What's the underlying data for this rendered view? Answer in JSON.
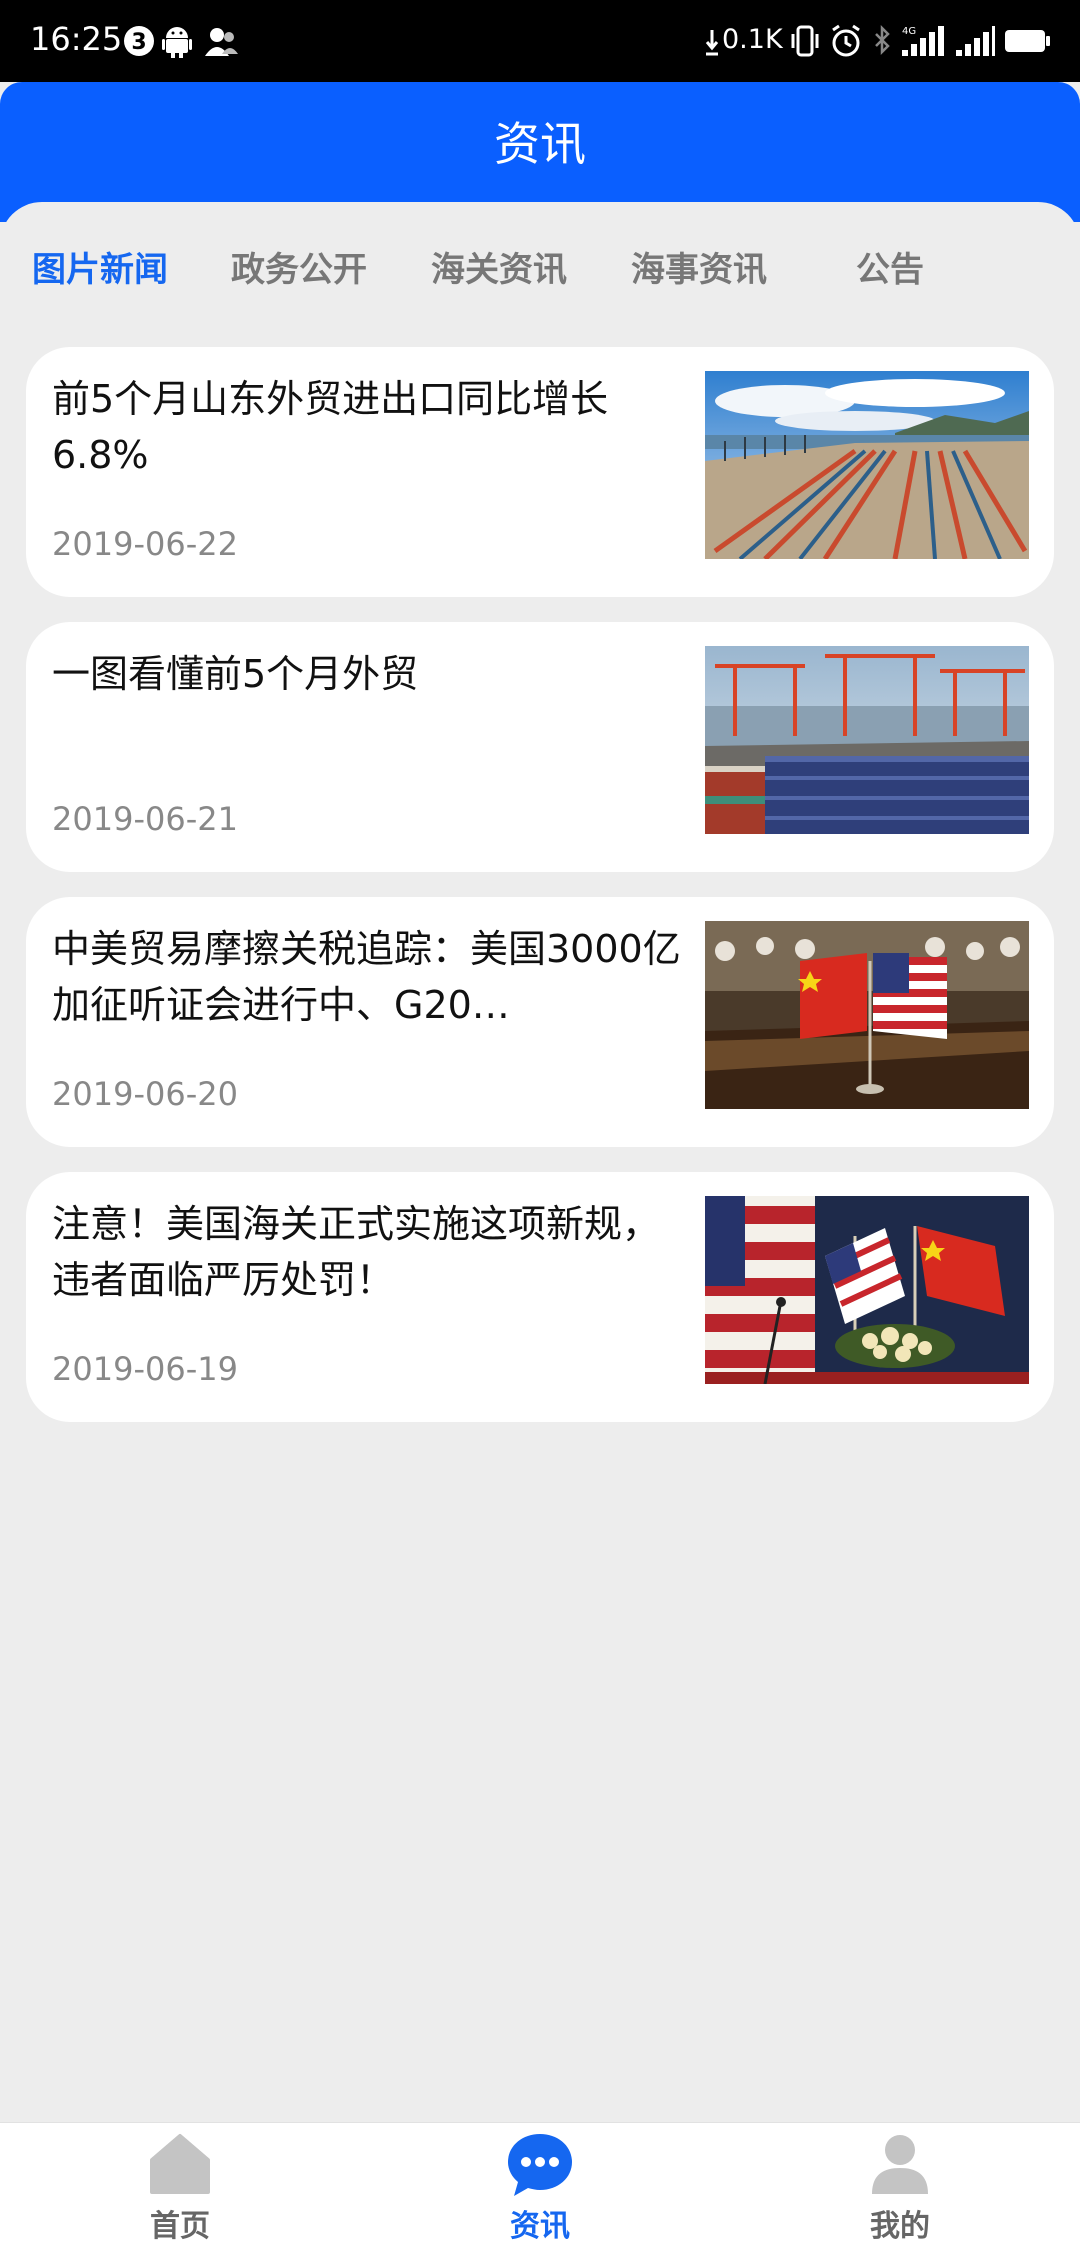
{
  "status_bar": {
    "time": "16:25",
    "notification_count": "3",
    "net_speed": "0.1K",
    "signal_type": "4G"
  },
  "header": {
    "title": "资讯"
  },
  "tabs": [
    {
      "label": "图片新闻",
      "active": true
    },
    {
      "label": "政务公开",
      "active": false
    },
    {
      "label": "海关资讯",
      "active": false
    },
    {
      "label": "海事资讯",
      "active": false
    },
    {
      "label": "公告",
      "active": false
    }
  ],
  "news": [
    {
      "title": "前5个月山东外贸进出口同比增长6.8%",
      "date": "2019-06-22",
      "image": "container-port-photo"
    },
    {
      "title": "一图看懂前5个月外贸",
      "date": "2019-06-21",
      "image": "cargo-terminal-photo"
    },
    {
      "title": "中美贸易摩擦关税追踪：美国3000亿加征听证会进行中、G20…",
      "date": "2019-06-20",
      "image": "china-us-flags-table-photo"
    },
    {
      "title": "注意！美国海关正式实施这项新规，违者面临严厉处罚！",
      "date": "2019-06-19",
      "image": "us-china-flags-photo"
    }
  ],
  "bottom_nav": [
    {
      "label": "首页",
      "icon": "home-icon",
      "active": false
    },
    {
      "label": "资讯",
      "icon": "chat-bubble-icon",
      "active": true
    },
    {
      "label": "我的",
      "icon": "user-icon",
      "active": false
    }
  ],
  "colors": {
    "primary": "#0a5fff",
    "tab_active": "#1567f0",
    "background": "#ededed",
    "text_secondary": "#888888"
  }
}
